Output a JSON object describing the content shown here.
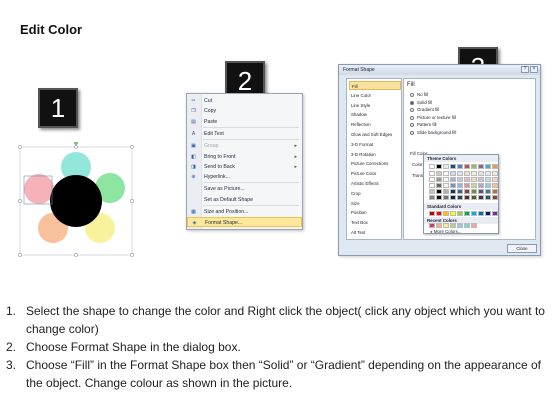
{
  "title": "Edit Color",
  "steps": [
    "1",
    "2",
    "3"
  ],
  "context_menu": {
    "items": [
      {
        "label": "Cut",
        "icon": "scissors-icon",
        "glyph": "✂",
        "disabled": false,
        "submenu": false
      },
      {
        "label": "Copy",
        "icon": "copy-icon",
        "glyph": "❐",
        "disabled": false,
        "submenu": false
      },
      {
        "label": "Paste",
        "icon": "paste-icon",
        "glyph": "▤",
        "disabled": false,
        "submenu": false
      },
      {
        "label": "Edit Text",
        "icon": "edit-text-icon",
        "glyph": "A",
        "disabled": false,
        "submenu": false
      },
      {
        "label": "Group",
        "icon": "group-icon",
        "glyph": "▣",
        "disabled": true,
        "submenu": true
      },
      {
        "label": "Bring to Front",
        "icon": "bring-to-front-icon",
        "glyph": "◧",
        "disabled": false,
        "submenu": true
      },
      {
        "label": "Send to Back",
        "icon": "send-to-back-icon",
        "glyph": "◨",
        "disabled": false,
        "submenu": true
      },
      {
        "label": "Hyperlink...",
        "icon": "hyperlink-icon",
        "glyph": "⊕",
        "disabled": false,
        "submenu": false
      },
      {
        "label": "Save as Picture...",
        "icon": "",
        "glyph": "",
        "disabled": false,
        "submenu": false
      },
      {
        "label": "Set as Default Shape",
        "icon": "",
        "glyph": "",
        "disabled": false,
        "submenu": false
      },
      {
        "label": "Size and Position...",
        "icon": "size-position-icon",
        "glyph": "▦",
        "disabled": false,
        "submenu": false
      },
      {
        "label": "Format Shape...",
        "icon": "format-shape-icon",
        "glyph": "◈",
        "disabled": false,
        "submenu": false,
        "highlight": true
      }
    ]
  },
  "dialog": {
    "title": "Format Shape",
    "categories": [
      "Fill",
      "Line Color",
      "Line Style",
      "Shadow",
      "Reflection",
      "Glow and Soft Edges",
      "3-D Format",
      "3-D Rotation",
      "Picture Corrections",
      "Picture Color",
      "Artistic Effects",
      "Crop",
      "Size",
      "Position",
      "Text Box",
      "Alt Text"
    ],
    "selected_category": "Fill",
    "section_title": "Fill",
    "fill_options": [
      "No fill",
      "Solid fill",
      "Gradient fill",
      "Picture or texture fill",
      "Pattern fill",
      "Slide background fill"
    ],
    "fill_color_label": "Fill Color",
    "color_label": "Color:",
    "transparency_label": "Transpa",
    "selected_fill": "Solid fill",
    "close_label": "Close"
  },
  "palette": {
    "theme_colors_label": "Theme Colors",
    "standard_colors_label": "Standard Colors",
    "recent_colors_label": "Recent Colors",
    "more_colors_label": "More Colors...",
    "theme_top": [
      "#ffffff",
      "#000000",
      "#eeece1",
      "#1f497d",
      "#4f81bd",
      "#c0504d",
      "#9bbb59",
      "#8064a2",
      "#4bacc6",
      "#f79646"
    ],
    "standard": [
      "#c00000",
      "#ff0000",
      "#ffc000",
      "#ffff00",
      "#92d050",
      "#00b050",
      "#00b0f0",
      "#0070c0",
      "#002060",
      "#7030a0"
    ],
    "recent": [
      "#d9367a",
      "#f4b183",
      "#ffe699",
      "#a9d18e",
      "#9dc3e6",
      "#7fd6c7",
      "#f8a1a8"
    ]
  },
  "shapes": {
    "center_color": "#000000",
    "petals": [
      "#7fe3d4",
      "#78e08f",
      "#f6f08a",
      "#f7b68a",
      "#f5a3ad"
    ]
  },
  "instructions": [
    "Select the shape to change the color and Right click the object( click any object which you want to change color)",
    "Choose Format Shape in the dialog box.",
    "Choose “Fill” in the Format Shape box then “Solid” or “Gradient” depending on the appearance of the object. Change colour as shown in the picture."
  ]
}
